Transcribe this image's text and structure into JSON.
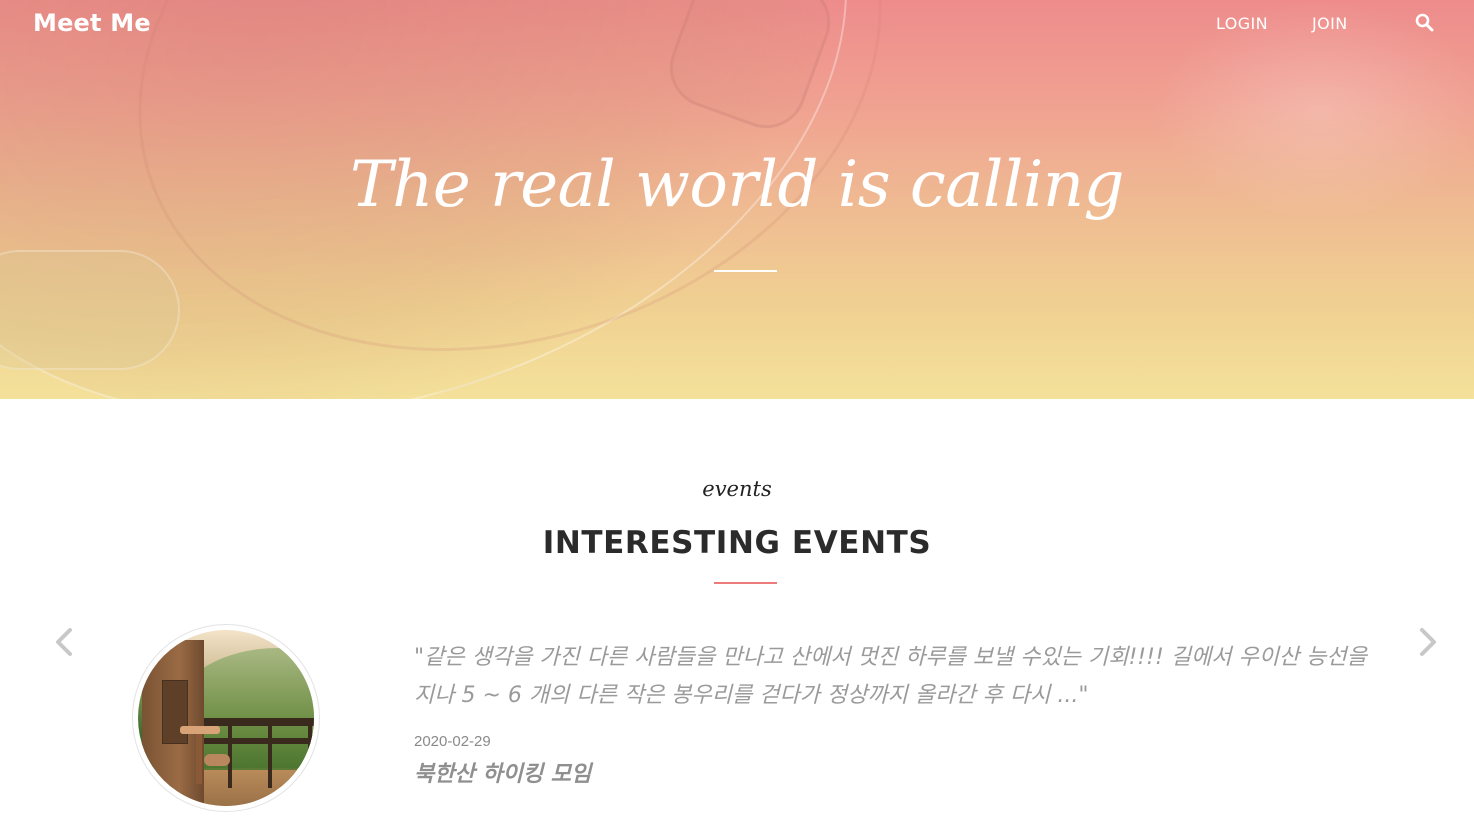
{
  "header": {
    "brand": "Meet Me",
    "nav": [
      {
        "label": "LOGIN"
      },
      {
        "label": "JOIN"
      }
    ],
    "search_icon": "search-icon"
  },
  "hero": {
    "title": "The real world is calling",
    "gradient_colors": [
      "#ee8c8c",
      "#f4e19a"
    ]
  },
  "events": {
    "subtitle": "events",
    "title": "INTERESTING EVENTS",
    "divider_color": "#ee7b7b",
    "prev_icon": "chevron-left-icon",
    "next_icon": "chevron-right-icon",
    "current": {
      "quote": "\"같은 생각을 가진 다른 사람들을 만나고 산에서 멋진 하루를 보낼 수있는 기회!!!! 길에서 우이산 능선을지나 5 ~ 6 개의 다른 작은 봉우리를 걷다가 정상까지 올라간 후 다시 ...\"",
      "date": "2020-02-29",
      "title": "북한산 하이킹 모임"
    }
  }
}
